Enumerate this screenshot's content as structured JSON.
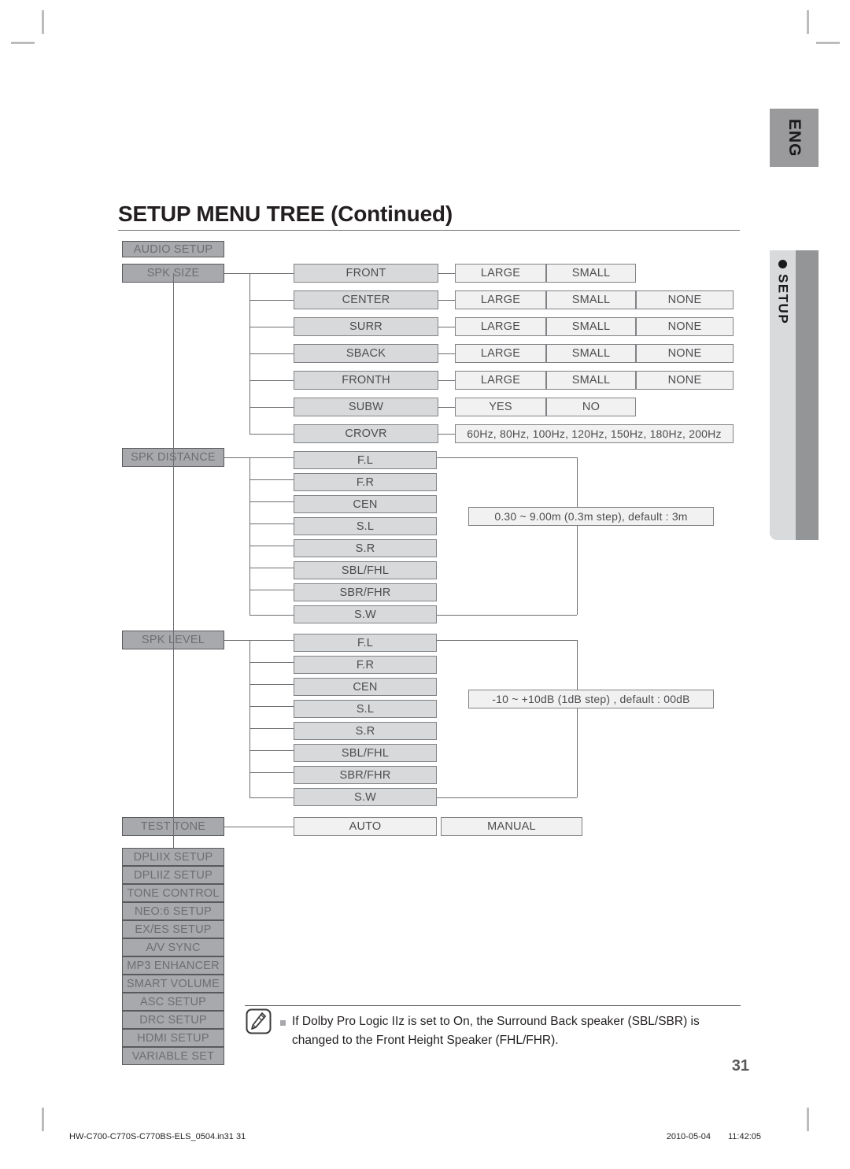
{
  "page": {
    "title": "SETUP MENU TREE (Continued)",
    "number": "31",
    "language_tab": "ENG",
    "section_tab": "SETUP"
  },
  "footer": {
    "filename": "HW-C700-C770S-C770BS-ELS_0504.in31   31",
    "date": "2010-05-04",
    "time": "11:42:05"
  },
  "note": {
    "text": "If Dolby Pro Logic IIz is set to On, the Surround Back speaker (SBL/SBR) is changed to the Front Height Speaker (FHL/FHR).",
    "icon": "note-pen-icon"
  },
  "menu": {
    "root": "AUDIO SETUP",
    "items": [
      {
        "label": "SPK SIZE"
      },
      {
        "label": "SPK DISTANCE"
      },
      {
        "label": "SPK LEVEL"
      },
      {
        "label": "TEST TONE"
      },
      {
        "label": "DPLIIX SETUP"
      },
      {
        "label": "DPLIIZ SETUP"
      },
      {
        "label": "TONE CONTROL"
      },
      {
        "label": "NEO:6 SETUP"
      },
      {
        "label": "EX/ES SETUP"
      },
      {
        "label": "A/V SYNC"
      },
      {
        "label": "MP3 ENHANCER"
      },
      {
        "label": "SMART VOLUME"
      },
      {
        "label": "ASC SETUP"
      },
      {
        "label": "DRC SETUP"
      },
      {
        "label": "HDMI SETUP"
      },
      {
        "label": "VARIABLE SET"
      }
    ]
  },
  "spk_size": {
    "rows": [
      {
        "name": "FRONT",
        "options": [
          "LARGE",
          "SMALL"
        ]
      },
      {
        "name": "CENTER",
        "options": [
          "LARGE",
          "SMALL",
          "NONE"
        ]
      },
      {
        "name": "SURR",
        "options": [
          "LARGE",
          "SMALL",
          "NONE"
        ]
      },
      {
        "name": "SBACK",
        "options": [
          "LARGE",
          "SMALL",
          "NONE"
        ]
      },
      {
        "name": "FRONTH",
        "options": [
          "LARGE",
          "SMALL",
          "NONE"
        ]
      },
      {
        "name": "SUBW",
        "options": [
          "YES",
          "NO"
        ]
      }
    ],
    "crovr": {
      "name": "CROVR",
      "values": "60Hz, 80Hz, 100Hz, 120Hz, 150Hz, 180Hz, 200Hz"
    }
  },
  "spk_distance": {
    "channels": [
      "F.L",
      "F.R",
      "CEN",
      "S.L",
      "S.R",
      "SBL/FHL",
      "SBR/FHR",
      "S.W"
    ],
    "range": "0.30 ~ 9.00m (0.3m step), default : 3m"
  },
  "spk_level": {
    "channels": [
      "F.L",
      "F.R",
      "CEN",
      "S.L",
      "S.R",
      "SBL/FHL",
      "SBR/FHR",
      "S.W"
    ],
    "range": "-10 ~ +10dB (1dB step) , default : 00dB"
  },
  "test_tone": {
    "options": [
      "AUTO",
      "MANUAL"
    ]
  },
  "colors": {
    "level1_fill": "#a7a9ac",
    "level2_fill": "#d8d9da",
    "level3_fill": "#f1f1f2",
    "line": "#6d6e71",
    "tab_grey": "#939597"
  }
}
